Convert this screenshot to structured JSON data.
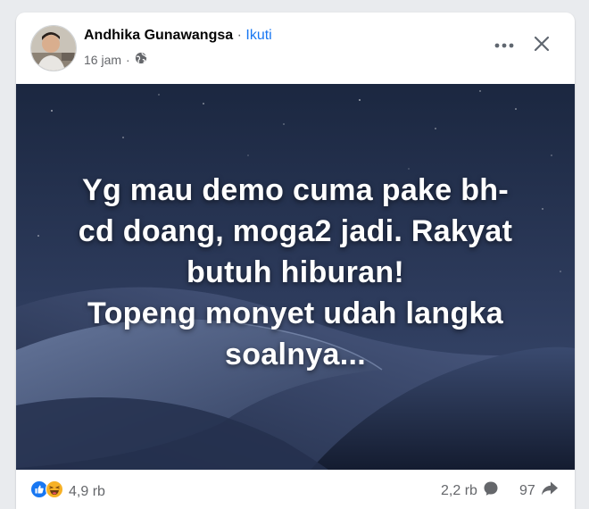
{
  "post": {
    "author_name": "Andhika Gunawangsa",
    "separator": "·",
    "follow_label": "Ikuti",
    "timestamp": "16 jam",
    "meta_separator": "·",
    "privacy_icon": "globe-icon",
    "text_lines": [
      "Yg mau demo cuma pake bh-",
      "cd doang, moga2 jadi. Rakyat",
      "butuh hiburan!",
      "Topeng monyet udah langka",
      "soalnya..."
    ],
    "background_colors": {
      "sky_top": "#1e2b45",
      "sky_mid": "#2e3e60",
      "dune": "#5a6a8e"
    }
  },
  "toolbar": {
    "more_icon": "more-horizontal-icon",
    "close_icon": "close-icon"
  },
  "stats": {
    "reaction_icons": [
      "like-icon",
      "haha-icon"
    ],
    "reaction_count": "4,9 rb",
    "comment_count": "2,2 rb",
    "comment_icon": "comment-icon",
    "share_count": "97",
    "share_icon": "share-icon"
  },
  "colors": {
    "link_blue": "#1877f2",
    "secondary_text": "#65676b",
    "primary_text": "#050505"
  }
}
